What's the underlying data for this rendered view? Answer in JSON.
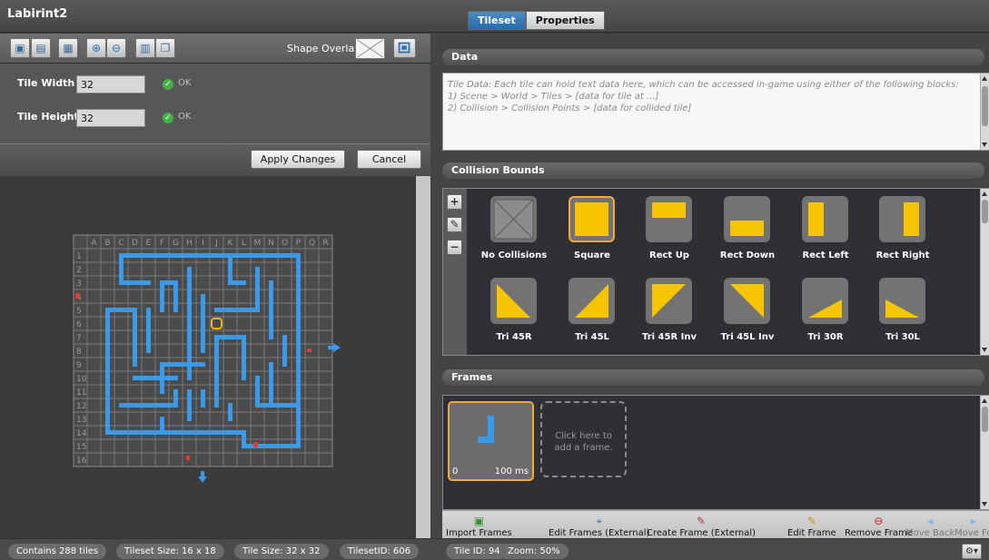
{
  "window": {
    "title": "Labirint2"
  },
  "tabs": [
    {
      "label": "Tileset",
      "active": true
    },
    {
      "label": "Properties",
      "active": false
    }
  ],
  "toolbar": {
    "icons": [
      "import-icon",
      "export-icon",
      "image-icon",
      "zoom-in-icon",
      "zoom-out-icon",
      "grid-icon",
      "copy-icon"
    ],
    "shape_overlay_label": "Shape Overlay"
  },
  "tile_props": {
    "width_label": "Tile Width",
    "width_value": "32",
    "width_status": "OK",
    "height_label": "Tile Height",
    "height_value": "32",
    "height_status": "OK"
  },
  "actions": {
    "apply_label": "Apply Changes",
    "cancel_label": "Cancel"
  },
  "grid": {
    "columns": [
      "A",
      "B",
      "C",
      "D",
      "E",
      "F",
      "G",
      "H",
      "I",
      "J",
      "K",
      "L",
      "M",
      "N",
      "O",
      "P",
      "Q",
      "R"
    ],
    "rows": [
      "1",
      "2",
      "3",
      "4",
      "5",
      "6",
      "7",
      "8",
      "9",
      "10",
      "11",
      "12",
      "13",
      "14",
      "15",
      "16"
    ],
    "wall_color": "#3b9ae8",
    "selected_color": "#f2b01e"
  },
  "data_section": {
    "title": "Data",
    "lines": [
      "Tile Data: Each tile can hold text data here, which can be accessed in-game using either of the following blocks:",
      "1) Scene > World > Tiles > [data for tile at ...]",
      "2) Collision > Collision Points > [data for collided tile]"
    ]
  },
  "collision": {
    "title": "Collision Bounds",
    "tools": [
      "+",
      "✎",
      "−"
    ],
    "items": [
      {
        "label": "No Collisions",
        "shape": "none"
      },
      {
        "label": "Square",
        "shape": "square",
        "selected": true
      },
      {
        "label": "Rect Up",
        "shape": "rect-up"
      },
      {
        "label": "Rect Down",
        "shape": "rect-down"
      },
      {
        "label": "Rect Left",
        "shape": "rect-left"
      },
      {
        "label": "Rect Right",
        "shape": "rect-right"
      },
      {
        "label": "Tri 45R",
        "shape": "tri-45r"
      },
      {
        "label": "Tri 45L",
        "shape": "tri-45l"
      },
      {
        "label": "Tri 45R Inv",
        "shape": "tri-45r-inv"
      },
      {
        "label": "Tri 45L Inv",
        "shape": "tri-45l-inv"
      },
      {
        "label": "Tri 30R",
        "shape": "tri-30r"
      },
      {
        "label": "Tri 30L",
        "shape": "tri-30l"
      }
    ],
    "accent_color": "#f6c400"
  },
  "frames": {
    "title": "Frames",
    "frame_index": "0",
    "frame_duration": "100 ms",
    "add_line1": "Click here to",
    "add_line2": "add a frame.",
    "buttons": [
      {
        "label": "Import Frames",
        "icon": "import-frames-icon"
      },
      {
        "label": "Edit Frames (External)",
        "icon": "brush-icon"
      },
      {
        "label": "Create Frame (External)",
        "icon": "pen-tool-icon"
      },
      {
        "label": "Edit Frame",
        "icon": "pencil-icon"
      },
      {
        "label": "Remove Frame",
        "icon": "remove-icon"
      },
      {
        "label": "Move Back",
        "icon": "arrow-left-icon"
      },
      {
        "label": "Move Fo",
        "icon": "arrow-right-icon"
      }
    ]
  },
  "status": {
    "tiles": "Contains 288 tiles",
    "tileset_size": "Tileset Size: 16 x 18",
    "tile_size": "Tile Size: 32 x 32",
    "tileset_id": "TilesetID: 606",
    "tile_id": "Tile ID: 94",
    "zoom": "Zoom: 50%"
  }
}
